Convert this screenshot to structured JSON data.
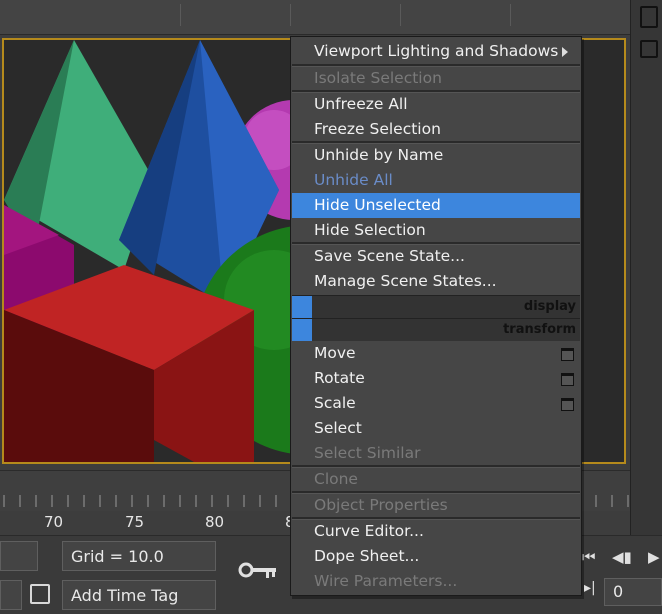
{
  "context_menu": {
    "items": [
      {
        "label": "Viewport Lighting and Shadows",
        "state": "normal",
        "submenu": true
      },
      {
        "label": "Isolate Selection",
        "state": "disabled"
      },
      {
        "label": "Unfreeze All",
        "state": "normal"
      },
      {
        "label": "Freeze Selection",
        "state": "normal"
      },
      {
        "label": "Unhide by Name",
        "state": "normal"
      },
      {
        "label": "Unhide All",
        "state": "disabled"
      },
      {
        "label": "Hide Unselected",
        "state": "highlighted"
      },
      {
        "label": "Hide Selection",
        "state": "normal"
      },
      {
        "label": "Save Scene State...",
        "state": "normal"
      },
      {
        "label": "Manage Scene States...",
        "state": "normal"
      },
      {
        "label": "Move",
        "state": "normal"
      },
      {
        "label": "Rotate",
        "state": "normal"
      },
      {
        "label": "Scale",
        "state": "normal"
      },
      {
        "label": "Select",
        "state": "normal"
      },
      {
        "label": "Select Similar",
        "state": "disabled"
      },
      {
        "label": "Clone",
        "state": "disabled"
      },
      {
        "label": "Object Properties",
        "state": "disabled"
      },
      {
        "label": "Curve Editor...",
        "state": "normal"
      },
      {
        "label": "Dope Sheet...",
        "state": "normal"
      },
      {
        "label": "Wire Parameters...",
        "state": "disabled"
      }
    ],
    "quadrants": {
      "display": "display",
      "transform": "transform"
    }
  },
  "timeline": {
    "frames": [
      "70",
      "75",
      "80",
      "8"
    ]
  },
  "status_bar": {
    "grid_label": "Grid = 10.0",
    "add_time_tag": "Add Time Tag",
    "frame_value": "0"
  },
  "colors": {
    "highlight": "#3d86dd",
    "viewport_border": "#b58a1c",
    "menu_bg": "#464646"
  },
  "icons": {
    "key": "key-icon",
    "submenu_arrow": "submenu-arrow-icon"
  }
}
